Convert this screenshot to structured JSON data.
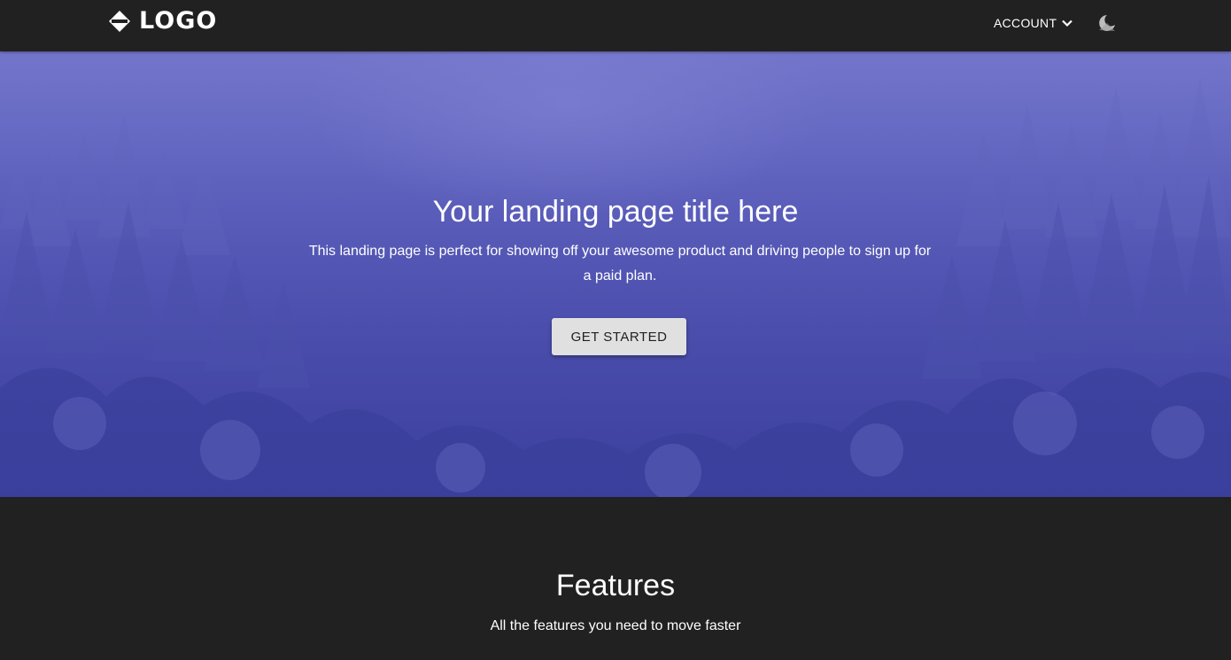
{
  "navbar": {
    "logo_text": "LOGO",
    "logo_icon": "diamond-logo-icon",
    "account_label": "ACCOUNT",
    "account_icon": "chevron-down-icon",
    "theme_icon": "dark-mode-toggle-icon"
  },
  "hero": {
    "title": "Your landing page title here",
    "subtitle": "This landing page is perfect for showing off your awesome product and driving people to sign up for a paid plan.",
    "cta_label": "GET STARTED",
    "overlay_color": "#4649a8"
  },
  "features": {
    "title": "Features",
    "subtitle": "All the features you need to move faster"
  },
  "colors": {
    "page_background": "#212121",
    "button_background": "#e0e0e0",
    "text": "#ffffff"
  }
}
